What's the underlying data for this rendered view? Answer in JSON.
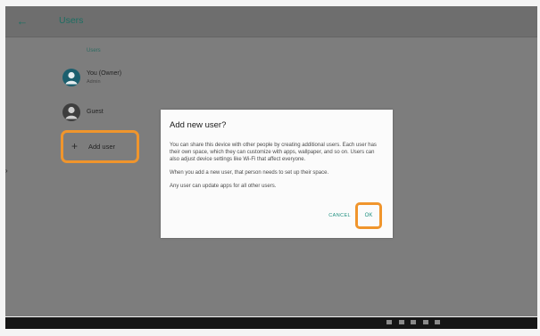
{
  "appbar": {
    "title": "Users",
    "back_icon": "arrow-left-icon"
  },
  "users": {
    "section_label": "Users",
    "owner": {
      "name": "You (Owner)",
      "role": "Admin"
    },
    "guest": {
      "name": "Guest"
    },
    "add_user": {
      "label": "Add user"
    }
  },
  "dialog": {
    "title": "Add new user?",
    "paragraphs": [
      "You can share this device with other people by creating additional users. Each user has their own space, which they can customize with apps, wallpaper, and so on. Users can also adjust device settings like Wi-Fi that affect everyone.",
      "When you add a new user, that person needs to set up their space.",
      "Any user can update apps for all other users."
    ],
    "cancel_label": "CANCEL",
    "ok_label": "OK"
  },
  "colors": {
    "accent": "#1d8f7f",
    "highlight": "#f0952c",
    "scrim": "#7d7d7d"
  }
}
